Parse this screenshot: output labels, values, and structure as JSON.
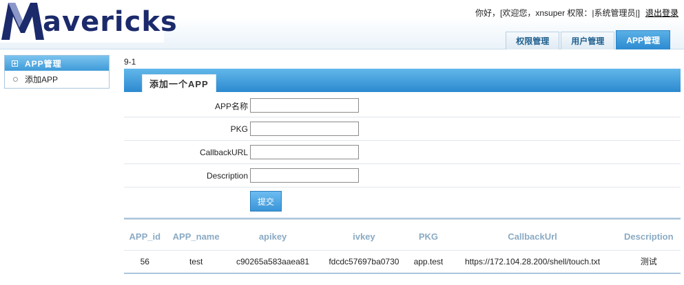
{
  "header": {
    "logo_text": "avericks",
    "user_info": "你好，[欢迎您，xnsuper 权限：|系统管理员|]",
    "logout_label": "退出登录",
    "tabs": [
      {
        "label": "权限管理"
      },
      {
        "label": "用户管理"
      },
      {
        "label": "APP管理",
        "active": true
      }
    ]
  },
  "sidebar": {
    "section_title": "APP管理",
    "items": [
      {
        "label": "添加APP"
      }
    ]
  },
  "main": {
    "breadcrumb": "9-1",
    "panel_title": "添加一个APP",
    "form": {
      "fields": [
        {
          "label": "APP名称",
          "value": ""
        },
        {
          "label": "PKG",
          "value": ""
        },
        {
          "label": "CallbackURL",
          "value": ""
        },
        {
          "label": "Description",
          "value": ""
        }
      ],
      "submit_label": "提交"
    },
    "table": {
      "headers": [
        "APP_id",
        "APP_name",
        "apikey",
        "ivkey",
        "PKG",
        "CallbackUrl",
        "Description"
      ],
      "rows": [
        [
          "56",
          "test",
          "c90265a583aaea81",
          "fdcdc57697ba0730",
          "app.test",
          "https://172.104.28.200/shell/touch.txt",
          "测试"
        ]
      ]
    }
  },
  "colors": {
    "accent": "#3a95d8",
    "logo": "#1b2a6b",
    "header_text": "#8aaac4"
  }
}
